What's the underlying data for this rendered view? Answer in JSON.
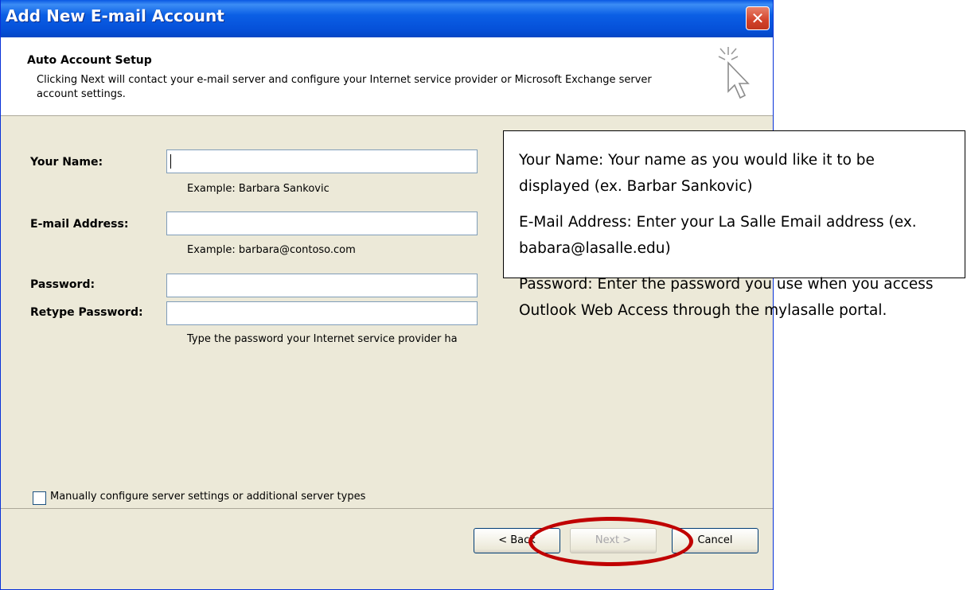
{
  "window": {
    "title": "Add New E-mail Account",
    "close_glyph": "✕"
  },
  "header": {
    "title": "Auto Account Setup",
    "description": "Clicking Next will contact your e-mail server and configure your Internet service provider or Microsoft Exchange server account settings."
  },
  "form": {
    "your_name": {
      "label": "Your Name:",
      "value": "",
      "hint": "Example: Barbara Sankovic"
    },
    "email": {
      "label": "E-mail Address:",
      "value": "",
      "hint": "Example: barbara@contoso.com"
    },
    "password": {
      "label": "Password:",
      "value": ""
    },
    "retype_password": {
      "label": "Retype Password:",
      "value": "",
      "hint": "Type the password your Internet service provider ha"
    }
  },
  "manual_config": {
    "label": "Manually configure server settings or additional server types",
    "checked": false
  },
  "buttons": {
    "back": "< Back",
    "next": "Next >",
    "cancel": "Cancel"
  },
  "callout": {
    "name_note": "Your Name: Your name as you would like it to be displayed (ex. Barbar  Sankovic)",
    "email_note": "E-Mail Address: Enter your La Salle Email address (ex. babara@lasalle.edu)",
    "password_note": "Password: Enter the password you use when you access Outlook Web Access through the mylasalle portal."
  },
  "colors": {
    "titlebar": "#0b5fe5",
    "dialog_bg": "#ece9d8",
    "highlight_ellipse": "#c00000"
  },
  "icons": [
    "close-icon",
    "cursor-wizard-icon",
    "checkbox-icon"
  ]
}
